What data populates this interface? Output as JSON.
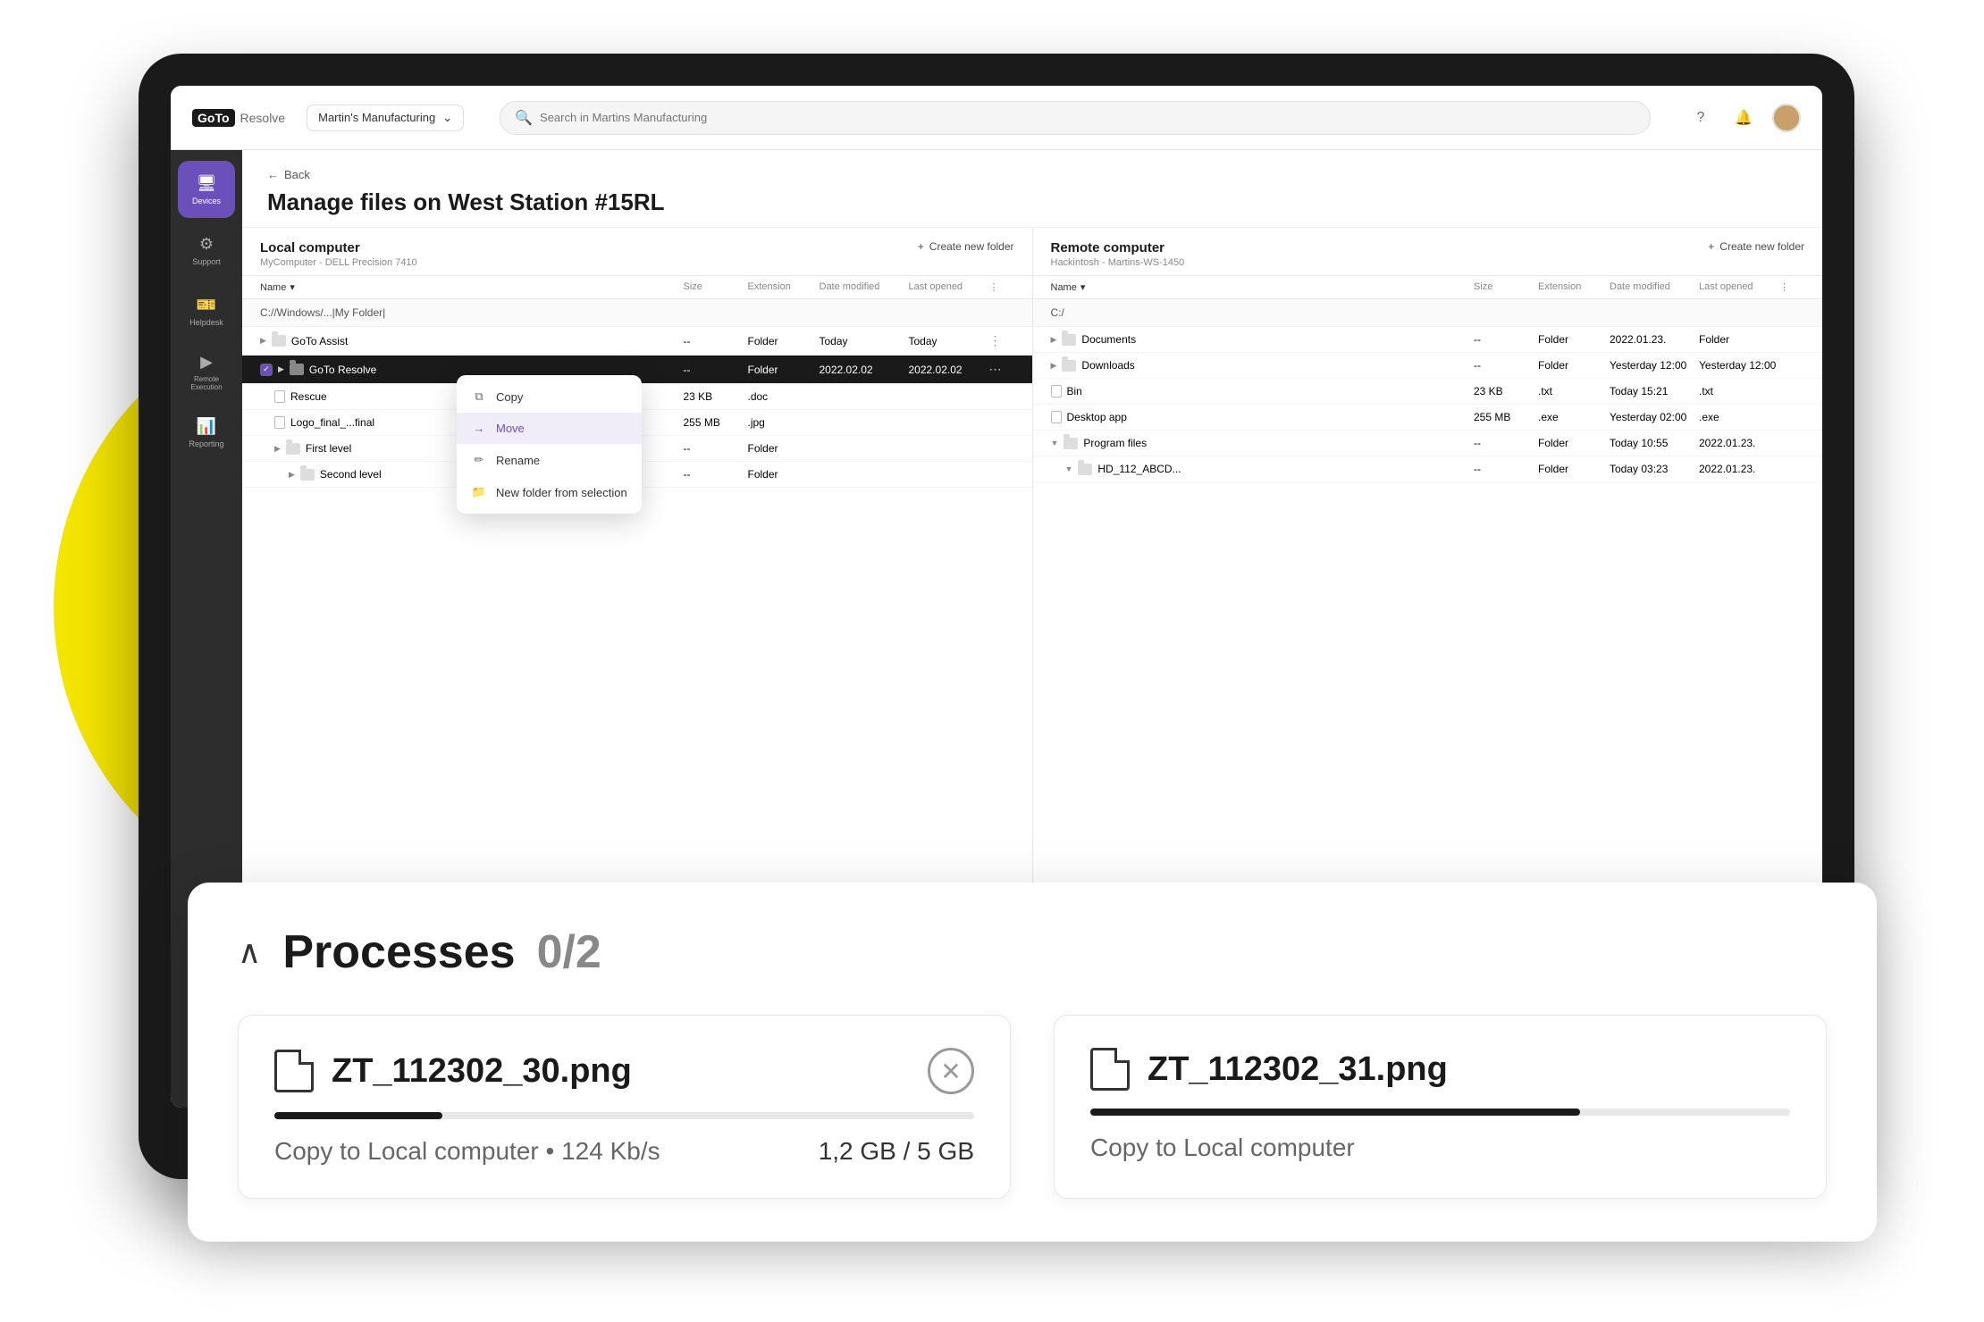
{
  "scene": {
    "background": "#f0f0f0"
  },
  "topbar": {
    "logo_text": "GoTo",
    "logo_sub": "Resolve",
    "org_name": "Martin's Manufacturing",
    "search_placeholder": "Search in Martins Manufacturing",
    "help_icon": "?",
    "bell_icon": "🔔"
  },
  "sidebar": {
    "items": [
      {
        "label": "Devices",
        "icon": "🖥",
        "active": true
      },
      {
        "label": "Support",
        "icon": "⚙"
      },
      {
        "label": "Helpdesk",
        "icon": "🎫"
      },
      {
        "label": "Remote\nExecution",
        "icon": "▶"
      },
      {
        "label": "Reporting",
        "icon": "📊"
      }
    ]
  },
  "page": {
    "back_label": "Back",
    "title": "Manage files on West Station #15RL"
  },
  "local_pane": {
    "title": "Local computer",
    "subtitle": "MyComputer - DELL Precision 7410",
    "create_folder_label": "+ Create new folder",
    "col_name": "Name",
    "col_size": "Size",
    "col_extension": "Extension",
    "col_date_modified": "Date modified",
    "col_last_opened": "Last opened",
    "current_path": "C://Windows/...|My Folder|",
    "rows": [
      {
        "name": "GoTo Assist",
        "size": "--",
        "ext": "Folder",
        "date": "Today",
        "opened": "Today",
        "type": "folder",
        "indent": 0,
        "selected": false
      },
      {
        "name": "GoTo Resolve",
        "size": "--",
        "ext": "Folder",
        "date": "2022.02.02",
        "opened": "2022.02.02",
        "type": "folder",
        "indent": 0,
        "selected": true
      },
      {
        "name": "Rescue",
        "size": "23 KB",
        "ext": ".doc",
        "date": "",
        "opened": "",
        "type": "file",
        "indent": 1,
        "selected": false
      },
      {
        "name": "Logo_final_...final",
        "size": "255 MB",
        "ext": ".jpg",
        "date": "",
        "opened": "",
        "type": "file",
        "indent": 1,
        "selected": false
      },
      {
        "name": "First level",
        "size": "--",
        "ext": "Folder",
        "date": "",
        "opened": "",
        "type": "folder",
        "indent": 1,
        "selected": false
      },
      {
        "name": "Second level",
        "size": "--",
        "ext": "Folder",
        "date": "",
        "opened": "",
        "type": "folder",
        "indent": 2,
        "selected": false
      }
    ]
  },
  "remote_pane": {
    "title": "Remote computer",
    "subtitle": "Hackintosh - Martins-WS-1450",
    "create_folder_label": "+ Create new folder",
    "col_name": "Name",
    "col_size": "Size",
    "col_extension": "Extension",
    "col_date_modified": "Date modified",
    "col_last_opened": "Last opened",
    "current_path": "C:/",
    "rows": [
      {
        "name": "Documents",
        "size": "--",
        "ext": "Folder",
        "date": "2022.01.23.",
        "opened": "Folder",
        "type": "folder",
        "indent": 0
      },
      {
        "name": "Downloads",
        "size": "--",
        "ext": "Folder",
        "date": "Yesterday 12:00",
        "opened": "Yesterday 12:00",
        "type": "folder",
        "indent": 0
      },
      {
        "name": "Bin",
        "size": "23 KB",
        "ext": ".txt",
        "date": "Today 15:21",
        "opened": ".txt",
        "type": "file",
        "indent": 0
      },
      {
        "name": "Desktop app",
        "size": "255 MB",
        "ext": ".exe",
        "date": "Yesterday 02:00",
        "opened": ".exe",
        "type": "file",
        "indent": 0
      },
      {
        "name": "Program files",
        "size": "--",
        "ext": "Folder",
        "date": "Today 10:55",
        "opened": "2022.01.23.",
        "type": "folder",
        "indent": 0
      },
      {
        "name": "HD_112_ABCD...",
        "size": "--",
        "ext": "Folder",
        "date": "Today 03:23",
        "opened": "2022.01.23.",
        "type": "folder",
        "indent": 1
      }
    ]
  },
  "context_menu": {
    "items": [
      {
        "label": "Copy",
        "icon": "⧉"
      },
      {
        "label": "Move",
        "icon": "→",
        "hovered": true
      },
      {
        "label": "Rename",
        "icon": "✏"
      },
      {
        "label": "New folder from selection",
        "icon": "📁"
      }
    ]
  },
  "processes": {
    "title": "Processes",
    "count": "0/2",
    "chevron": "^",
    "items": [
      {
        "filename": "ZT_112302_30.png",
        "subtitle": "Copy to Local computer • 124 Kb/s",
        "size_label": "1,2 GB / 5 GB",
        "progress": 24,
        "has_cancel": true
      },
      {
        "filename": "ZT_112302_31.png",
        "subtitle": "Copy to Local computer",
        "size_label": "",
        "progress": 70,
        "has_cancel": false
      }
    ]
  }
}
